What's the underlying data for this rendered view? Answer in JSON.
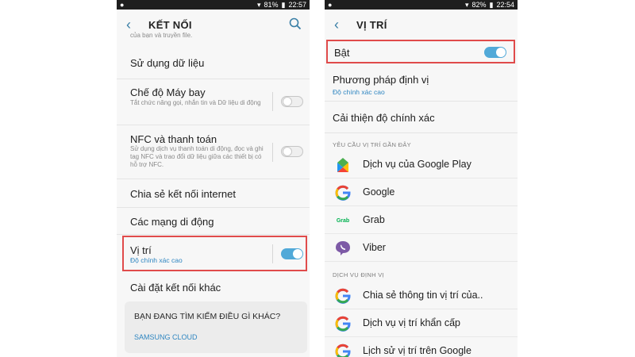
{
  "left": {
    "status": {
      "time": "22:57",
      "battery": "81%"
    },
    "title": "KẾT NỐI",
    "cut_text": "của bạn và truyền file.",
    "rows": [
      {
        "title": "Sử dụng dữ liệu"
      },
      {
        "title": "Chế độ Máy bay",
        "sub": "Tắt chức năng gọi, nhắn tin và Dữ liệu di động",
        "toggle": false
      },
      {
        "title": "NFC và thanh toán",
        "sub": "Sử dụng dịch vụ thanh toán di động, đọc và ghi tag NFC và trao đổi dữ liệu giữa các thiết bị có hỗ trợ NFC.",
        "toggle": false
      },
      {
        "title": "Chia sẻ kết nối internet"
      },
      {
        "title": "Các mạng di động"
      },
      {
        "title": "Vị trí",
        "sub": "Độ chính xác cao",
        "toggle": true
      },
      {
        "title": "Cài đặt kết nối khác"
      }
    ],
    "card": {
      "title": "BẠN ĐANG TÌM KIẾM ĐIỀU GÌ KHÁC?",
      "link": "SAMSUNG CLOUD"
    }
  },
  "right": {
    "status": {
      "time": "22:54",
      "battery": "82%"
    },
    "title": "VỊ TRÍ",
    "master": {
      "label": "Bật",
      "on": true
    },
    "method": {
      "title": "Phương pháp định vị",
      "sub": "Độ chính xác cao"
    },
    "improve": "Cải thiện độ chính xác",
    "recent_header": "YÊU CẦU VỊ TRÍ GẦN ĐÂY",
    "recent_apps": [
      {
        "name": "Dịch vụ của Google Play",
        "icon": "google-play-services-icon"
      },
      {
        "name": "Google",
        "icon": "google-icon"
      },
      {
        "name": "Grab",
        "icon": "grab-icon",
        "icon_text": "Grab"
      },
      {
        "name": "Viber",
        "icon": "viber-icon"
      }
    ],
    "services_header": "DỊCH VỤ ĐỊNH VỊ",
    "services": [
      {
        "name": "Chia sẻ thông tin vị trí của..",
        "icon": "google-icon"
      },
      {
        "name": "Dịch vụ vị trí khẩn cấp",
        "icon": "google-icon"
      },
      {
        "name": "Lịch sử vị trí trên Google",
        "icon": "google-icon"
      }
    ]
  },
  "colors": {
    "accent": "#3a7fa6",
    "toggle_on": "#51a9d8",
    "highlight": "#e04b4b",
    "link": "#2f86c1"
  }
}
